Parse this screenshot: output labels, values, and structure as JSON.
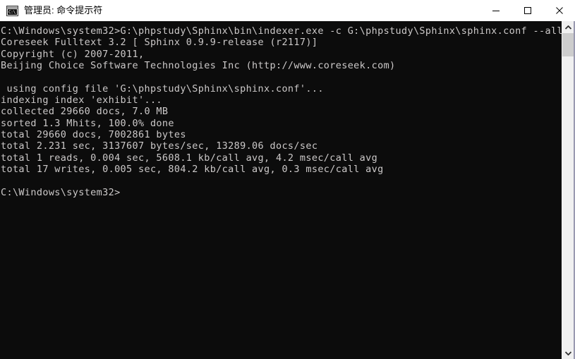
{
  "window": {
    "title": "管理员: 命令提示符",
    "icon_name": "cmd-icon",
    "icon_text": "C:\\",
    "background_color": "#0c0c0c",
    "text_color": "#ccc9c9",
    "titlebar_color": "#ffffff"
  },
  "controls": {
    "minimize_label": "最小化",
    "maximize_label": "最大化",
    "close_label": "关闭"
  },
  "scrollbar": {
    "up_arrow_label": "向上滚动",
    "down_arrow_label": "向下滚动",
    "thumb_label": "滚动滑块"
  },
  "console": {
    "lines": [
      "C:\\Windows\\system32>G:\\phpstudy\\Sphinx\\bin\\indexer.exe -c G:\\phpstudy\\Sphinx\\sphinx.conf --all",
      "Coreseek Fulltext 3.2 [ Sphinx 0.9.9-release (r2117)]",
      "Copyright (c) 2007-2011,",
      "Beijing Choice Software Technologies Inc (http://www.coreseek.com)",
      "",
      " using config file 'G:\\phpstudy\\Sphinx\\sphinx.conf'...",
      "indexing index 'exhibit'...",
      "collected 29660 docs, 7.0 MB",
      "sorted 1.3 Mhits, 100.0% done",
      "total 29660 docs, 7002861 bytes",
      "total 2.231 sec, 3137607 bytes/sec, 13289.06 docs/sec",
      "total 1 reads, 0.004 sec, 5608.1 kb/call avg, 4.2 msec/call avg",
      "total 17 writes, 0.005 sec, 804.2 kb/call avg, 0.3 msec/call avg",
      "",
      "C:\\Windows\\system32>"
    ],
    "text": "C:\\Windows\\system32>G:\\phpstudy\\Sphinx\\bin\\indexer.exe -c G:\\phpstudy\\Sphinx\\sphinx.conf --all\nCoreseek Fulltext 3.2 [ Sphinx 0.9.9-release (r2117)]\nCopyright (c) 2007-2011,\nBeijing Choice Software Technologies Inc (http://www.coreseek.com)\n\n using config file 'G:\\phpstudy\\Sphinx\\sphinx.conf'...\nindexing index 'exhibit'...\ncollected 29660 docs, 7.0 MB\nsorted 1.3 Mhits, 100.0% done\ntotal 29660 docs, 7002861 bytes\ntotal 2.231 sec, 3137607 bytes/sec, 13289.06 docs/sec\ntotal 1 reads, 0.004 sec, 5608.1 kb/call avg, 4.2 msec/call avg\ntotal 17 writes, 0.005 sec, 804.2 kb/call avg, 0.3 msec/call avg\n\nC:\\Windows\\system32>",
    "stats": {
      "program": "Coreseek Fulltext",
      "program_version": "3.2",
      "sphinx_version": "Sphinx 0.9.9-release (r2117)",
      "copyright_years": "2007-2011",
      "vendor": "Beijing Choice Software Technologies Inc",
      "vendor_url": "http://www.coreseek.com",
      "config_file": "G:\\phpstudy\\Sphinx\\sphinx.conf",
      "index_name": "exhibit",
      "collected_docs": "29660",
      "collected_size": "7.0 MB",
      "sorted_hits": "1.3 Mhits",
      "sorted_percent": "100.0%",
      "total_docs": "29660",
      "total_bytes": "7002861",
      "total_seconds": "2.231",
      "bytes_per_sec": "3137607",
      "docs_per_sec": "13289.06",
      "reads": "1",
      "read_seconds": "0.004",
      "read_kb_per_call": "5608.1",
      "read_msec_per_call": "4.2",
      "writes": "17",
      "write_seconds": "0.005",
      "write_kb_per_call": "804.2",
      "write_msec_per_call": "0.3"
    },
    "prompt": "C:\\Windows\\system32>"
  }
}
